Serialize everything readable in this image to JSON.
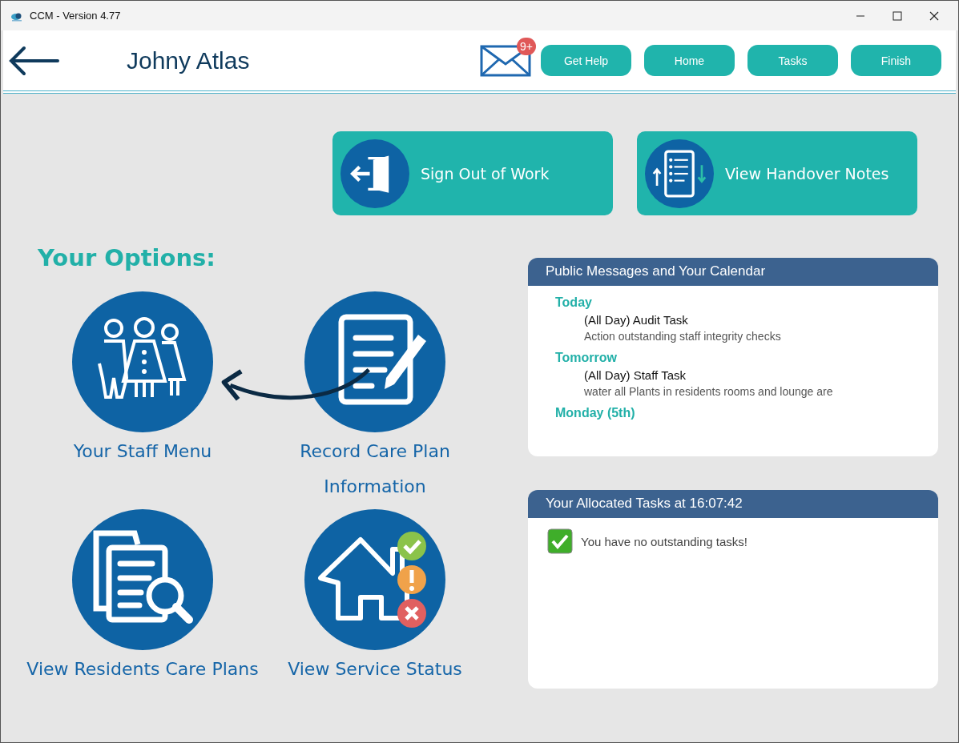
{
  "window": {
    "title": "CCM - Version 4.77"
  },
  "header": {
    "user_name": "Johny Atlas",
    "mail_badge": "9+",
    "buttons": [
      "Get Help",
      "Home",
      "Tasks",
      "Finish"
    ]
  },
  "actions": [
    {
      "label": "Sign Out of Work",
      "kind": "sign-out"
    },
    {
      "label": "View Handover Notes",
      "kind": "handover"
    }
  ],
  "options": {
    "title": "Your Options:",
    "items": [
      {
        "label": "Your Staff Menu",
        "kind": "staff"
      },
      {
        "label": "Record Care Plan Information",
        "kind": "record"
      },
      {
        "label": "View Residents Care Plans",
        "kind": "residents"
      },
      {
        "label": "View Service Status",
        "kind": "status"
      }
    ]
  },
  "calendar": {
    "title": "Public Messages and Your Calendar",
    "days": [
      {
        "day": "Today",
        "events": [
          {
            "title": "(All Day) Audit Task",
            "detail": "Action outstanding staff integrity checks"
          }
        ]
      },
      {
        "day": "Tomorrow",
        "events": [
          {
            "title": "(All Day) Staff Task",
            "detail": "water all Plants in residents rooms and lounge are"
          }
        ]
      },
      {
        "day": "Monday (5th)"
      }
    ]
  },
  "tasks": {
    "title": "Your Allocated Tasks at 16:07:42",
    "message": "You have no outstanding tasks!"
  }
}
